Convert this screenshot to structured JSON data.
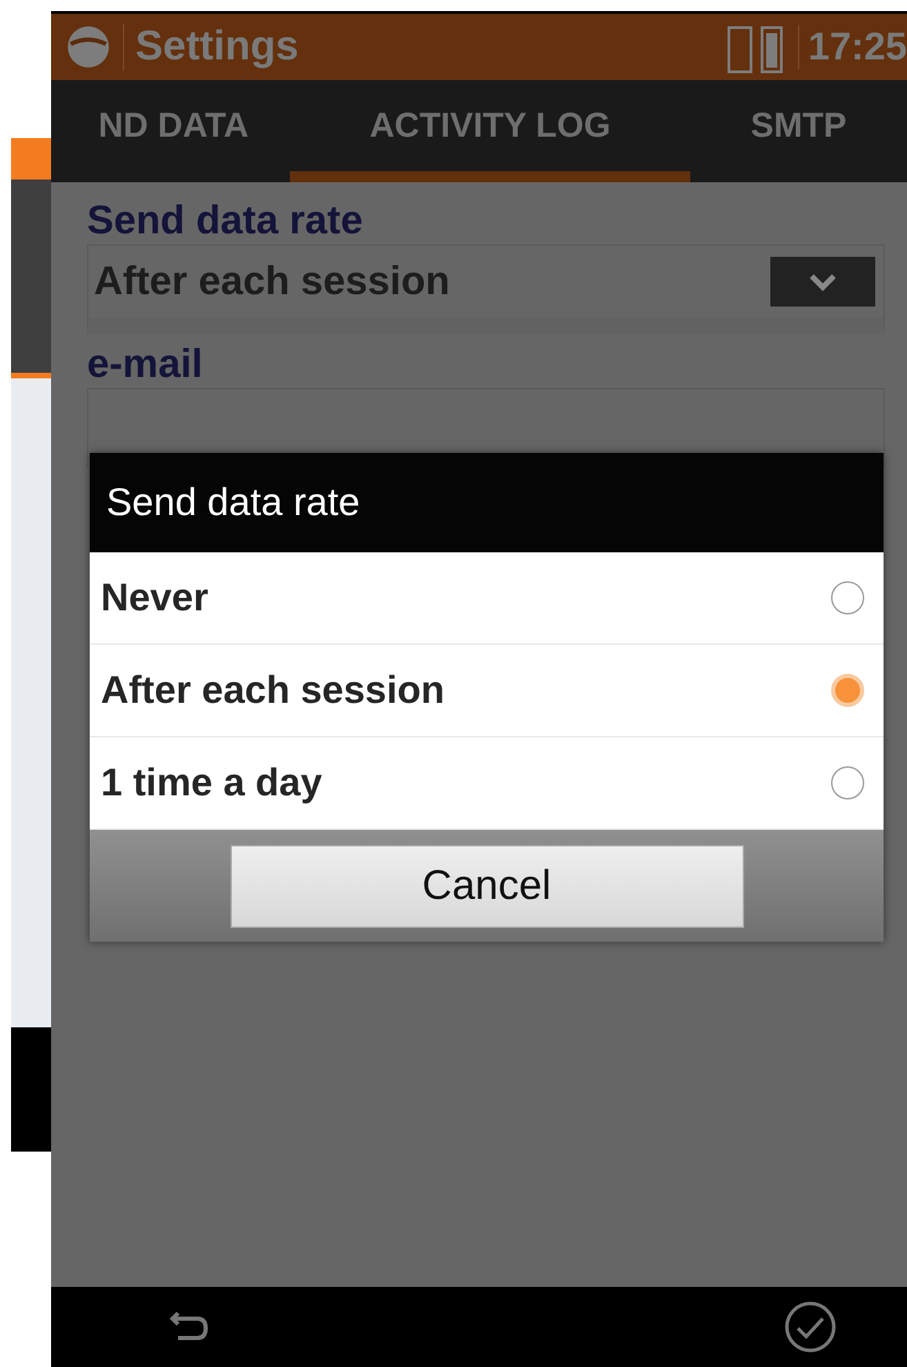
{
  "status_bar": {
    "title": "Settings",
    "time": "17:25"
  },
  "tabs": [
    {
      "label": "ND DATA",
      "selected": false
    },
    {
      "label": "ACTIVITY LOG",
      "selected": true
    },
    {
      "label": "SMTP",
      "selected": false
    }
  ],
  "form": {
    "fields": [
      {
        "kind": "dropdown",
        "label": "Send data rate",
        "value": "After each session"
      },
      {
        "kind": "text",
        "label": "e-mail"
      }
    ]
  },
  "dialog": {
    "title": "Send data rate",
    "options": [
      {
        "label": "Never",
        "selected": false
      },
      {
        "label": "After each session",
        "selected": true
      },
      {
        "label": "1 time a day",
        "selected": false
      }
    ],
    "button": "Cancel"
  }
}
